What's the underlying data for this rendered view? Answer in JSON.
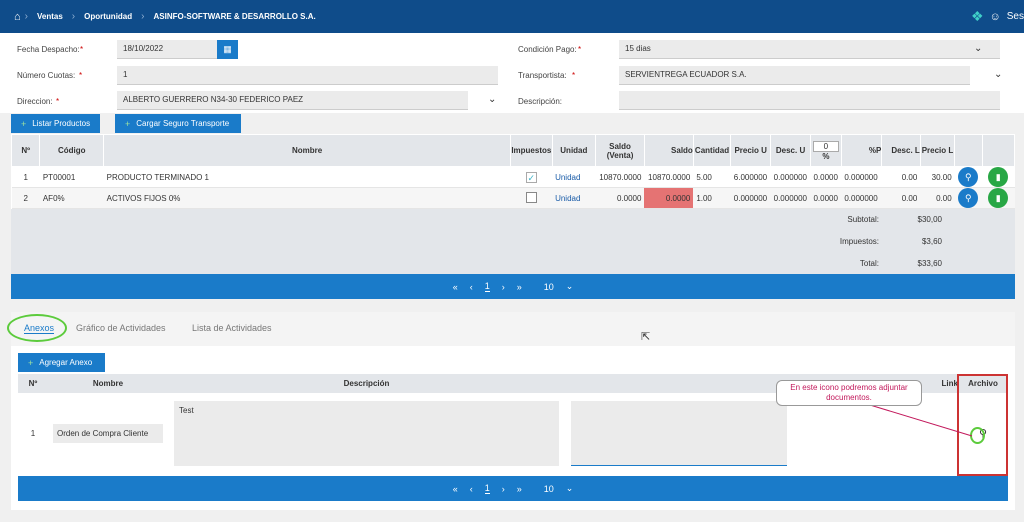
{
  "header": {
    "crumbs": [
      "Ventas",
      "Oportunidad",
      "ASINFO-SOFTWARE & DESARROLLO S.A."
    ],
    "user": "Ses"
  },
  "form": {
    "fecha_label": "Fecha Despacho:",
    "fecha_value": "18/10/2022",
    "cuotas_label": "Número Cuotas:",
    "cuotas_value": "1",
    "direccion_label": "Direccion:",
    "direccion_value": "ALBERTO GUERRERO N34-30 FEDERICO PAEZ",
    "condicion_label": "Condición Pago:",
    "condicion_value": "15 dias",
    "transportista_label": "Transportista:",
    "transportista_value": "SERVIENTREGA ECUADOR S.A.",
    "descripcion_label": "Descripción:",
    "descripcion_value": ""
  },
  "buttons": {
    "listar": "Listar Productos",
    "cargar": "Cargar Seguro Transporte",
    "agregar": "Agregar Anexo"
  },
  "products": {
    "headers": [
      "Nº",
      "Código",
      "Nombre",
      "Impuestos",
      "Unidad",
      "Saldo (Venta)",
      "Saldo",
      "Cantidad",
      "Precio U",
      "Desc. U",
      "0",
      "%P",
      "Desc. L",
      "Precio L"
    ],
    "pct_sub": "%",
    "rows": [
      {
        "n": "1",
        "codigo": "PT00001",
        "nombre": "PRODUCTO TERMINADO 1",
        "imp": true,
        "unidad": "Unidad",
        "saldo_venta": "10870.0000",
        "saldo": "10870.0000",
        "cantidad": "5.00",
        "precio_u": "6.000000",
        "desc_u": "0.000000",
        "pct": "0.0000",
        "pp": "0.000000",
        "desc_l": "0.00",
        "precio_l": "30.00"
      },
      {
        "n": "2",
        "codigo": "AF0%",
        "nombre": "ACTIVOS FIJOS 0%",
        "imp": false,
        "unidad": "Unidad",
        "saldo_venta": "0.0000",
        "saldo": "0.0000",
        "cantidad": "1.00",
        "precio_u": "0.000000",
        "desc_u": "0.000000",
        "pct": "0.0000",
        "pp": "0.000000",
        "desc_l": "0.00",
        "precio_l": "0.00"
      }
    ],
    "subtotal_label": "Subtotal:",
    "subtotal": "$30,00",
    "impuestos_label": "Impuestos:",
    "impuestos": "$3,60",
    "total_label": "Total:",
    "total": "$33,60"
  },
  "pager": {
    "page": "1",
    "size": "10"
  },
  "tabs": [
    "Anexos",
    "Gráfico de Actividades",
    "Lista de Actividades"
  ],
  "annex": {
    "headers": [
      "Nº",
      "Nombre",
      "Descripción",
      "Link",
      "Archivo"
    ],
    "row": {
      "n": "1",
      "nombre": "Orden de Compra Cliente",
      "descripcion": "Test",
      "link": ""
    }
  },
  "callout": "En este icono podremos adjuntar documentos."
}
